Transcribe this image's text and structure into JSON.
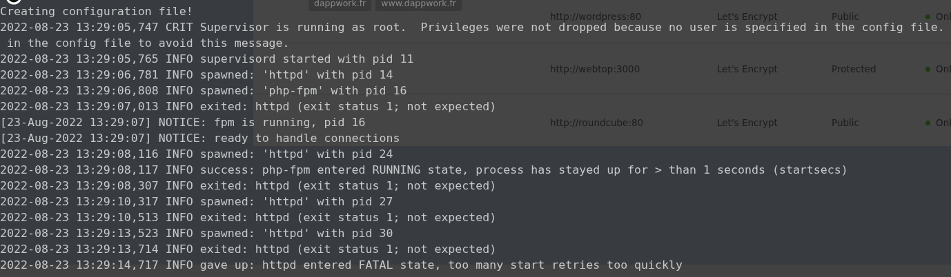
{
  "web_page": {
    "rows": [
      {
        "tags": [
          "dappwork.fr",
          "www.dappwork.fr"
        ],
        "destination": "http://wordpress:80",
        "ssl": "Let's Encrypt",
        "access": "Public",
        "status": "Onl"
      },
      {
        "destination": "http://webtop:3000",
        "ssl": "Let's Encrypt",
        "access": "Protected",
        "status": "Onl"
      },
      {
        "destination": "http://roundcube:80",
        "ssl": "Let's Encrypt",
        "access": "Public",
        "status": "Onl"
      }
    ]
  },
  "terminal": {
    "lines": [
      "Creating configuration file!",
      "2022-08-23 13:29:05,747 CRIT Supervisor is running as root.  Privileges were not dropped because no user is specified in the config file.",
      " in the config file to avoid this message.",
      "2022-08-23 13:29:05,765 INFO supervisord started with pid 11",
      "2022-08-23 13:29:06,781 INFO spawned: 'httpd' with pid 14",
      "2022-08-23 13:29:06,808 INFO spawned: 'php-fpm' with pid 16",
      "2022-08-23 13:29:07,013 INFO exited: httpd (exit status 1; not expected)",
      "[23-Aug-2022 13:29:07] NOTICE: fpm is running, pid 16",
      "[23-Aug-2022 13:29:07] NOTICE: ready to handle connections",
      "2022-08-23 13:29:08,116 INFO spawned: 'httpd' with pid 24",
      "2022-08-23 13:29:08,117 INFO success: php-fpm entered RUNNING state, process has stayed up for > than 1 seconds (startsecs)",
      "2022-08-23 13:29:08,307 INFO exited: httpd (exit status 1; not expected)",
      "2022-08-23 13:29:10,317 INFO spawned: 'httpd' with pid 27",
      "2022-08-23 13:29:10,513 INFO exited: httpd (exit status 1; not expected)",
      "2022-08-23 13:29:13,523 INFO spawned: 'httpd' with pid 30",
      "2022-08-23 13:29:13,714 INFO exited: httpd (exit status 1; not expected)",
      "2022-08-23 13:29:14,717 INFO gave up: httpd entered FATAL state, too many start retries too quickly"
    ]
  }
}
